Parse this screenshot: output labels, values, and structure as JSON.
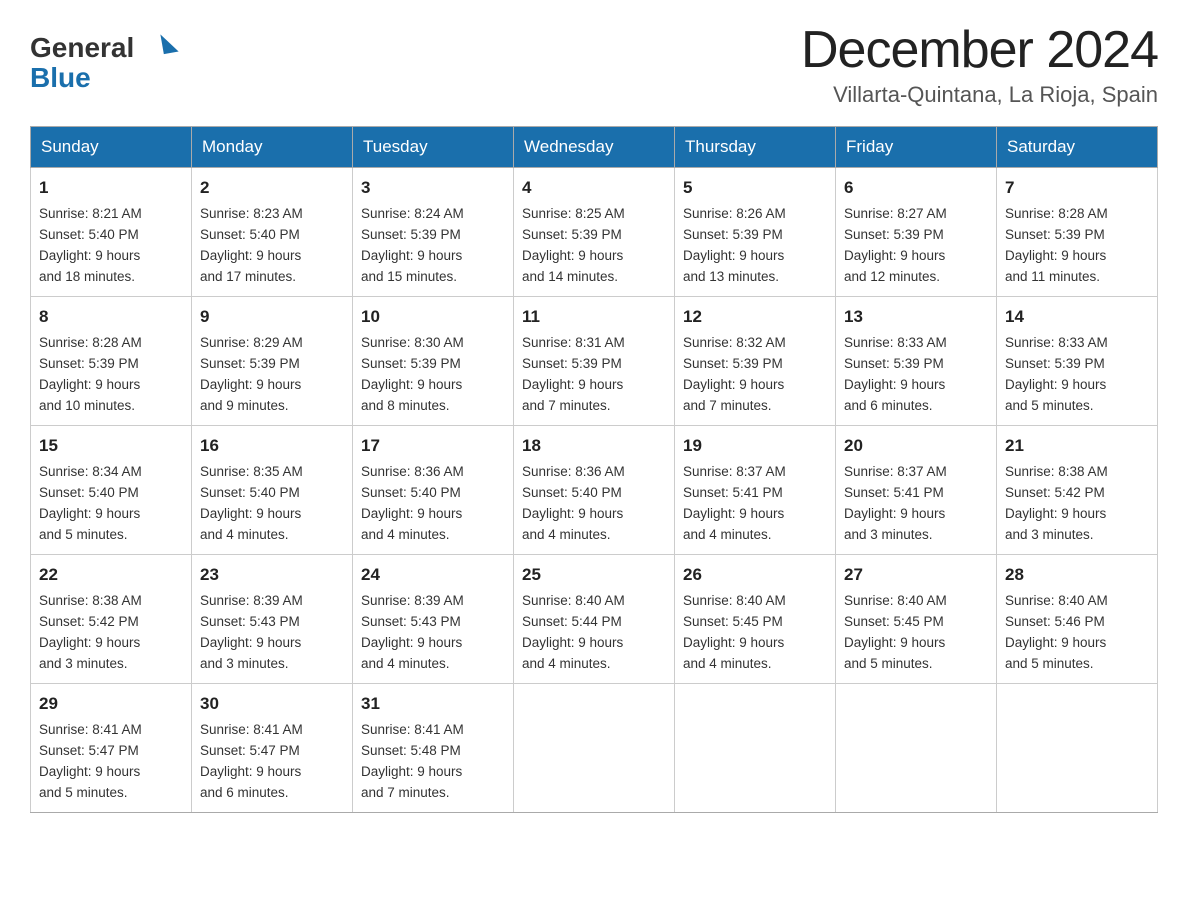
{
  "header": {
    "logo_general": "General",
    "logo_blue": "Blue",
    "month_title": "December 2024",
    "location": "Villarta-Quintana, La Rioja, Spain"
  },
  "weekdays": [
    "Sunday",
    "Monday",
    "Tuesday",
    "Wednesday",
    "Thursday",
    "Friday",
    "Saturday"
  ],
  "weeks": [
    [
      {
        "day": "1",
        "sunrise": "8:21 AM",
        "sunset": "5:40 PM",
        "daylight": "9 hours and 18 minutes."
      },
      {
        "day": "2",
        "sunrise": "8:23 AM",
        "sunset": "5:40 PM",
        "daylight": "9 hours and 17 minutes."
      },
      {
        "day": "3",
        "sunrise": "8:24 AM",
        "sunset": "5:39 PM",
        "daylight": "9 hours and 15 minutes."
      },
      {
        "day": "4",
        "sunrise": "8:25 AM",
        "sunset": "5:39 PM",
        "daylight": "9 hours and 14 minutes."
      },
      {
        "day": "5",
        "sunrise": "8:26 AM",
        "sunset": "5:39 PM",
        "daylight": "9 hours and 13 minutes."
      },
      {
        "day": "6",
        "sunrise": "8:27 AM",
        "sunset": "5:39 PM",
        "daylight": "9 hours and 12 minutes."
      },
      {
        "day": "7",
        "sunrise": "8:28 AM",
        "sunset": "5:39 PM",
        "daylight": "9 hours and 11 minutes."
      }
    ],
    [
      {
        "day": "8",
        "sunrise": "8:28 AM",
        "sunset": "5:39 PM",
        "daylight": "9 hours and 10 minutes."
      },
      {
        "day": "9",
        "sunrise": "8:29 AM",
        "sunset": "5:39 PM",
        "daylight": "9 hours and 9 minutes."
      },
      {
        "day": "10",
        "sunrise": "8:30 AM",
        "sunset": "5:39 PM",
        "daylight": "9 hours and 8 minutes."
      },
      {
        "day": "11",
        "sunrise": "8:31 AM",
        "sunset": "5:39 PM",
        "daylight": "9 hours and 7 minutes."
      },
      {
        "day": "12",
        "sunrise": "8:32 AM",
        "sunset": "5:39 PM",
        "daylight": "9 hours and 7 minutes."
      },
      {
        "day": "13",
        "sunrise": "8:33 AM",
        "sunset": "5:39 PM",
        "daylight": "9 hours and 6 minutes."
      },
      {
        "day": "14",
        "sunrise": "8:33 AM",
        "sunset": "5:39 PM",
        "daylight": "9 hours and 5 minutes."
      }
    ],
    [
      {
        "day": "15",
        "sunrise": "8:34 AM",
        "sunset": "5:40 PM",
        "daylight": "9 hours and 5 minutes."
      },
      {
        "day": "16",
        "sunrise": "8:35 AM",
        "sunset": "5:40 PM",
        "daylight": "9 hours and 4 minutes."
      },
      {
        "day": "17",
        "sunrise": "8:36 AM",
        "sunset": "5:40 PM",
        "daylight": "9 hours and 4 minutes."
      },
      {
        "day": "18",
        "sunrise": "8:36 AM",
        "sunset": "5:40 PM",
        "daylight": "9 hours and 4 minutes."
      },
      {
        "day": "19",
        "sunrise": "8:37 AM",
        "sunset": "5:41 PM",
        "daylight": "9 hours and 4 minutes."
      },
      {
        "day": "20",
        "sunrise": "8:37 AM",
        "sunset": "5:41 PM",
        "daylight": "9 hours and 3 minutes."
      },
      {
        "day": "21",
        "sunrise": "8:38 AM",
        "sunset": "5:42 PM",
        "daylight": "9 hours and 3 minutes."
      }
    ],
    [
      {
        "day": "22",
        "sunrise": "8:38 AM",
        "sunset": "5:42 PM",
        "daylight": "9 hours and 3 minutes."
      },
      {
        "day": "23",
        "sunrise": "8:39 AM",
        "sunset": "5:43 PM",
        "daylight": "9 hours and 3 minutes."
      },
      {
        "day": "24",
        "sunrise": "8:39 AM",
        "sunset": "5:43 PM",
        "daylight": "9 hours and 4 minutes."
      },
      {
        "day": "25",
        "sunrise": "8:40 AM",
        "sunset": "5:44 PM",
        "daylight": "9 hours and 4 minutes."
      },
      {
        "day": "26",
        "sunrise": "8:40 AM",
        "sunset": "5:45 PM",
        "daylight": "9 hours and 4 minutes."
      },
      {
        "day": "27",
        "sunrise": "8:40 AM",
        "sunset": "5:45 PM",
        "daylight": "9 hours and 5 minutes."
      },
      {
        "day": "28",
        "sunrise": "8:40 AM",
        "sunset": "5:46 PM",
        "daylight": "9 hours and 5 minutes."
      }
    ],
    [
      {
        "day": "29",
        "sunrise": "8:41 AM",
        "sunset": "5:47 PM",
        "daylight": "9 hours and 5 minutes."
      },
      {
        "day": "30",
        "sunrise": "8:41 AM",
        "sunset": "5:47 PM",
        "daylight": "9 hours and 6 minutes."
      },
      {
        "day": "31",
        "sunrise": "8:41 AM",
        "sunset": "5:48 PM",
        "daylight": "9 hours and 7 minutes."
      },
      null,
      null,
      null,
      null
    ]
  ],
  "labels": {
    "sunrise": "Sunrise:",
    "sunset": "Sunset:",
    "daylight": "Daylight:"
  }
}
